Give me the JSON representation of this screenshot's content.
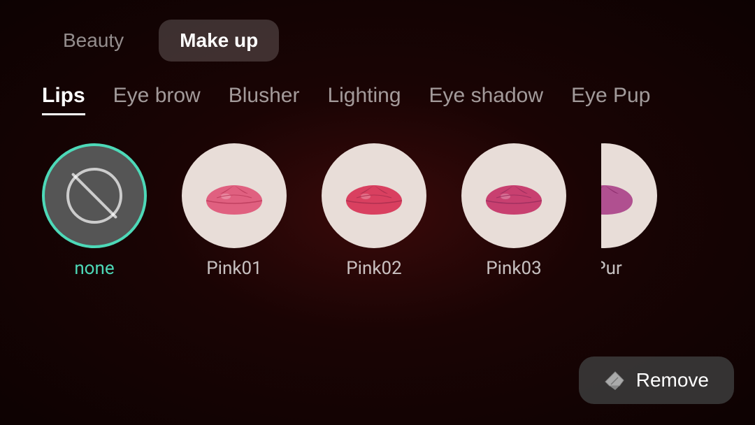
{
  "topTabs": {
    "items": [
      {
        "id": "beauty",
        "label": "Beauty",
        "active": false
      },
      {
        "id": "makeup",
        "label": "Make up",
        "active": true
      }
    ]
  },
  "categoryTabs": {
    "items": [
      {
        "id": "lips",
        "label": "Lips",
        "active": true
      },
      {
        "id": "eyebrow",
        "label": "Eye brow",
        "active": false
      },
      {
        "id": "blusher",
        "label": "Blusher",
        "active": false
      },
      {
        "id": "lighting",
        "label": "Lighting",
        "active": false
      },
      {
        "id": "eyeshadow",
        "label": "Eye shadow",
        "active": false
      },
      {
        "id": "eyepup",
        "label": "Eye Pup",
        "active": false
      }
    ]
  },
  "lipsItems": {
    "items": [
      {
        "id": "none",
        "label": "none",
        "type": "none",
        "selected": true
      },
      {
        "id": "pink01",
        "label": "Pink01",
        "type": "lips",
        "color": "#e06080",
        "selected": false
      },
      {
        "id": "pink02",
        "label": "Pink02",
        "type": "lips",
        "color": "#d94060",
        "selected": false
      },
      {
        "id": "pink03",
        "label": "Pink03",
        "type": "lips",
        "color": "#c84070",
        "selected": false
      },
      {
        "id": "pur",
        "label": "Pur",
        "type": "lips",
        "color": "#b05090",
        "selected": false,
        "partial": true
      }
    ]
  },
  "removeButton": {
    "label": "Remove"
  },
  "colors": {
    "selectedBorder": "#4dd9b8",
    "selectedLabel": "#4dd9b8",
    "accent": "#4dd9b8"
  }
}
